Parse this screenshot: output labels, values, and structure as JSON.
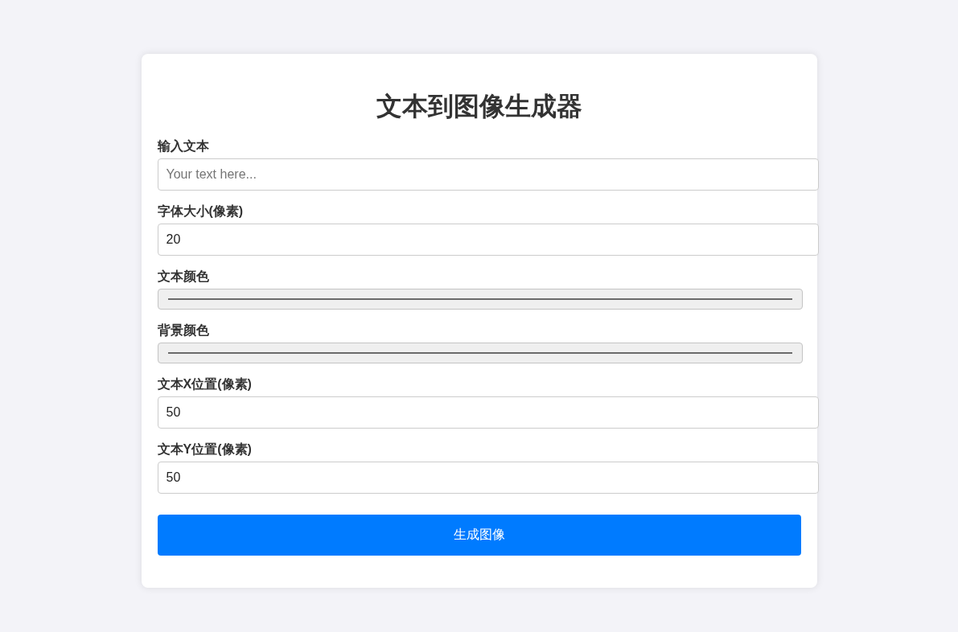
{
  "title": "文本到图像生成器",
  "fields": [
    {
      "kind": "text",
      "label": "输入文本",
      "placeholder": "Your text here..."
    },
    {
      "kind": "number",
      "label": "字体大小(像素)",
      "value": "20"
    },
    {
      "kind": "color",
      "label": "文本颜色"
    },
    {
      "kind": "color",
      "label": "背景颜色"
    },
    {
      "kind": "number",
      "label": "文本X位置(像素)",
      "value": "50"
    },
    {
      "kind": "number",
      "label": "文本Y位置(像素)",
      "value": "50"
    }
  ],
  "button": "生成图像"
}
